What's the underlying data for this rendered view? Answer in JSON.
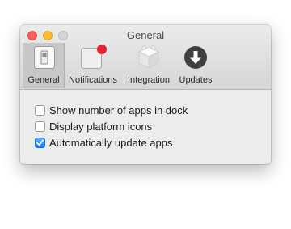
{
  "window": {
    "title": "General",
    "toolbar": [
      {
        "label": "General",
        "icon": "switch-icon",
        "selected": true
      },
      {
        "label": "Notifications",
        "icon": "notification-badge-icon",
        "badge_color": "#e5212e"
      },
      {
        "label": "Integration",
        "icon": "cube-icon"
      },
      {
        "label": "Updates",
        "icon": "download-arrow-icon"
      }
    ]
  },
  "settings": [
    {
      "label": "Show number of apps in dock",
      "checked": false
    },
    {
      "label": "Display platform icons",
      "checked": false
    },
    {
      "label": "Automatically update apps",
      "checked": true
    }
  ],
  "colors": {
    "checkbox_accent": "#1c7ff0",
    "close": "#fc5f57",
    "minimize": "#fdbc2e",
    "zoom": "#d6d4d6"
  }
}
